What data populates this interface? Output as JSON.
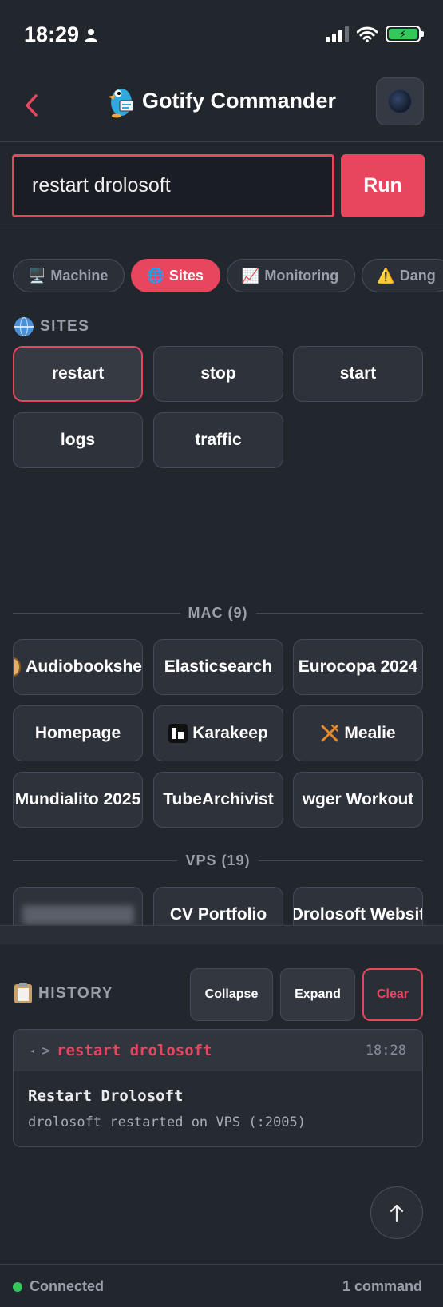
{
  "status_bar": {
    "time": "18:29"
  },
  "header": {
    "back_icon": "chevron-left-icon",
    "title": "Gotify Commander"
  },
  "command": {
    "value": "restart drolosoft",
    "run_label": "Run"
  },
  "tabs": [
    {
      "icon": "🖥️",
      "label": "Machine",
      "active": false
    },
    {
      "icon": "🌐",
      "label": "Sites",
      "active": true
    },
    {
      "icon": "📈",
      "label": "Monitoring",
      "active": false
    },
    {
      "icon": "⚠️",
      "label": "Dang",
      "active": false
    }
  ],
  "sites": {
    "heading": "SITES",
    "actions": [
      "restart",
      "stop",
      "start",
      "logs",
      "traffic"
    ],
    "selected": "restart"
  },
  "mac": {
    "heading": "MAC (9)",
    "items": [
      "Audiobookshe",
      "Elasticsearch",
      "Eurocopa 2024",
      "Homepage",
      "Karakeep",
      "Mealie",
      "Mundialito 2025",
      "TubeArchivist",
      "wger Workout"
    ]
  },
  "vps": {
    "heading": "VPS (19)",
    "items": [
      "CV Portfolio",
      "Drolosoft Websit"
    ]
  },
  "history": {
    "heading": "HISTORY",
    "collapse_label": "Collapse",
    "expand_label": "Expand",
    "clear_label": "Clear",
    "entries": [
      {
        "prompt": ">",
        "command": "restart drolosoft",
        "time": "18:28",
        "title": "Restart Drolosoft",
        "message": "drolosoft restarted on VPS (:2005)"
      }
    ]
  },
  "footer": {
    "status": "Connected",
    "count": "1 command"
  },
  "colors": {
    "accent": "#e8455f",
    "background": "#22262d",
    "connected": "#34c759"
  }
}
